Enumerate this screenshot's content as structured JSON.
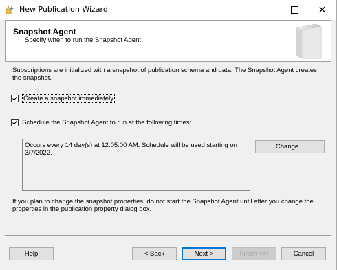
{
  "window": {
    "title": "New Publication Wizard",
    "controls": {
      "minimize": "—",
      "close": "✕"
    }
  },
  "header": {
    "title": "Snapshot Agent",
    "subtitle": "Specify when to run the Snapshot Agent."
  },
  "intro_text": "Subscriptions are initialized with a snapshot of publication schema and data. The Snapshot Agent creates the snapshot.",
  "options": {
    "create_snapshot": {
      "label": "Create a snapshot immediately",
      "checked": true
    },
    "schedule_agent": {
      "label": "Schedule the Snapshot Agent to run at the following times:",
      "checked": true
    }
  },
  "schedule_description": "Occurs every 14 day(s) at 12:05:00 AM. Schedule will be used starting on 3/7/2022.",
  "change_button": "Change...",
  "note_text": "If you plan to change the snapshot properties, do not start the Snapshot Agent until after you change the properties in the publication property dialog box.",
  "footer": {
    "help": "Help",
    "back": "< Back",
    "next": "Next >",
    "finish": "Finish >>|",
    "cancel": "Cancel"
  }
}
